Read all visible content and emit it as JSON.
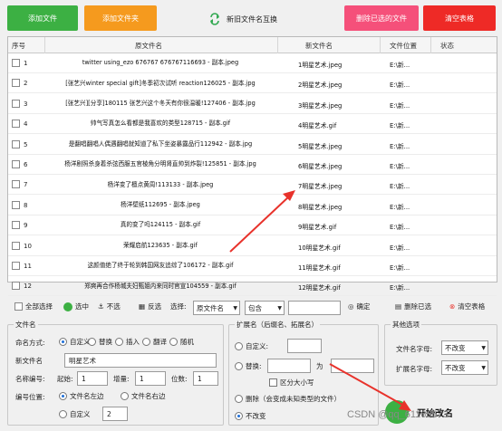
{
  "toolbar": {
    "add_file": "添加文件",
    "add_folder": "添加文件夹",
    "swap": "新旧文件名互换",
    "delete_selected": "删除已选的文件",
    "clear_table": "清空表格"
  },
  "grid": {
    "headers": [
      "序号",
      "原文件名",
      "新文件名",
      "文件位置",
      "状态"
    ],
    "rows": [
      {
        "num": "1",
        "orig": "twitter using_ezo 676767 676767116693 - 副本.jpeg",
        "new": "1明星艺术.jpeg",
        "loc": "E:\\新..."
      },
      {
        "num": "2",
        "orig": "[张艺兴winter special gift]冬季初次试听 reaction126025 - 副本.jpg",
        "new": "2明星艺术.jpeg",
        "loc": "E:\\新..."
      },
      {
        "num": "3",
        "orig": "[张艺兴][分享]180115 张艺兴这个冬天有你很温暖!127406 - 副本.jpg",
        "new": "3明星艺术.jpeg",
        "loc": "E:\\新..."
      },
      {
        "num": "4",
        "orig": "帅气写真怎么看都是我喜欢的类型128715 - 副本.gif",
        "new": "4明星艺术.gif",
        "loc": "E:\\新..."
      },
      {
        "num": "5",
        "orig": "是翻唱翻唱人偶遇翻唱就知道了私下坐姿暴露品行112942 - 副本.jpg",
        "new": "5明星艺术.jpeg",
        "loc": "E:\\新..."
      },
      {
        "num": "6",
        "orig": "杨洋剧照杀身着杀弦西服五官棱角分明肾直帅到炸裂!125851 - 副本.jpg",
        "new": "6明星艺术.jpeg",
        "loc": "E:\\新..."
      },
      {
        "num": "7",
        "orig": "杨洋变了檀点黄周!113133 - 副本.jpeg",
        "new": "7明星艺术.jpeg",
        "loc": "E:\\新..."
      },
      {
        "num": "8",
        "orig": "杨洋壁纸112695 - 副本.jpeg",
        "new": "8明星艺术.jpeg",
        "loc": "E:\\新..."
      },
      {
        "num": "9",
        "orig": "真的变了吗124115 - 副本.gif",
        "new": "9明星艺术.gif",
        "loc": "E:\\新..."
      },
      {
        "num": "10",
        "orig": "荣耀启航123635 - 副本.gif",
        "new": "10明星艺术.gif",
        "loc": "E:\\新..."
      },
      {
        "num": "11",
        "orig": "这颜值绝了终于轮到韩国网友追综了106172 - 副本.gif",
        "new": "11明星艺术.gif",
        "loc": "E:\\新..."
      },
      {
        "num": "12",
        "orig": "郑爽再合作杨城夫妇甄姐内来同时官宣104559 - 副本.gif",
        "new": "12明星艺术.gif",
        "loc": "E:\\新..."
      }
    ]
  },
  "selection": {
    "select_all": "全部选择",
    "select": "选中",
    "deselect": "不选",
    "invert": "反选",
    "choose_label": "选择:",
    "field_select": "原文件名",
    "cond_select": "包含",
    "confirm": "确定",
    "delete_selected": "删除已选",
    "clear_table": "清空表格"
  },
  "filename_group": {
    "title": "文件名",
    "naming_label": "命名方式:",
    "naming_options": [
      "自定义",
      "替换",
      "插入",
      "翻译",
      "随机"
    ],
    "new_name_label": "新文件名",
    "new_name_value": "明星艺术",
    "numbering_label": "名称编号:",
    "start_label": "起始:",
    "start_value": "1",
    "increment_label": "增量:",
    "increment_value": "1",
    "digits_label": "位数:",
    "digits_value": "1",
    "position_label": "编号位置:",
    "position_left": "文件名左边",
    "position_right": "文件名右边",
    "custom_label": "自定义",
    "custom_value": "2"
  },
  "ext_group": {
    "title": "扩展名（后缀名、拓展名）",
    "custom_label": "自定义:",
    "replace_label": "替换:",
    "to_label": "为",
    "case_label": "区分大小写",
    "delete_label": "删除（会变成未知类型的文件）",
    "nochange_label": "不改变"
  },
  "other_group": {
    "title": "其他选项",
    "filename_case_label": "文件名字母:",
    "filename_case_value": "不改变",
    "ext_case_label": "扩展名字母:",
    "ext_case_value": "不改变"
  },
  "start_button": "开始改名",
  "watermark": "CSDN @qq_61166673",
  "colors": {
    "green": "#3cb043",
    "orange": "#f59a1e",
    "pink": "#f5507a",
    "red": "#ee2a26",
    "arrow": "#e8322b"
  }
}
